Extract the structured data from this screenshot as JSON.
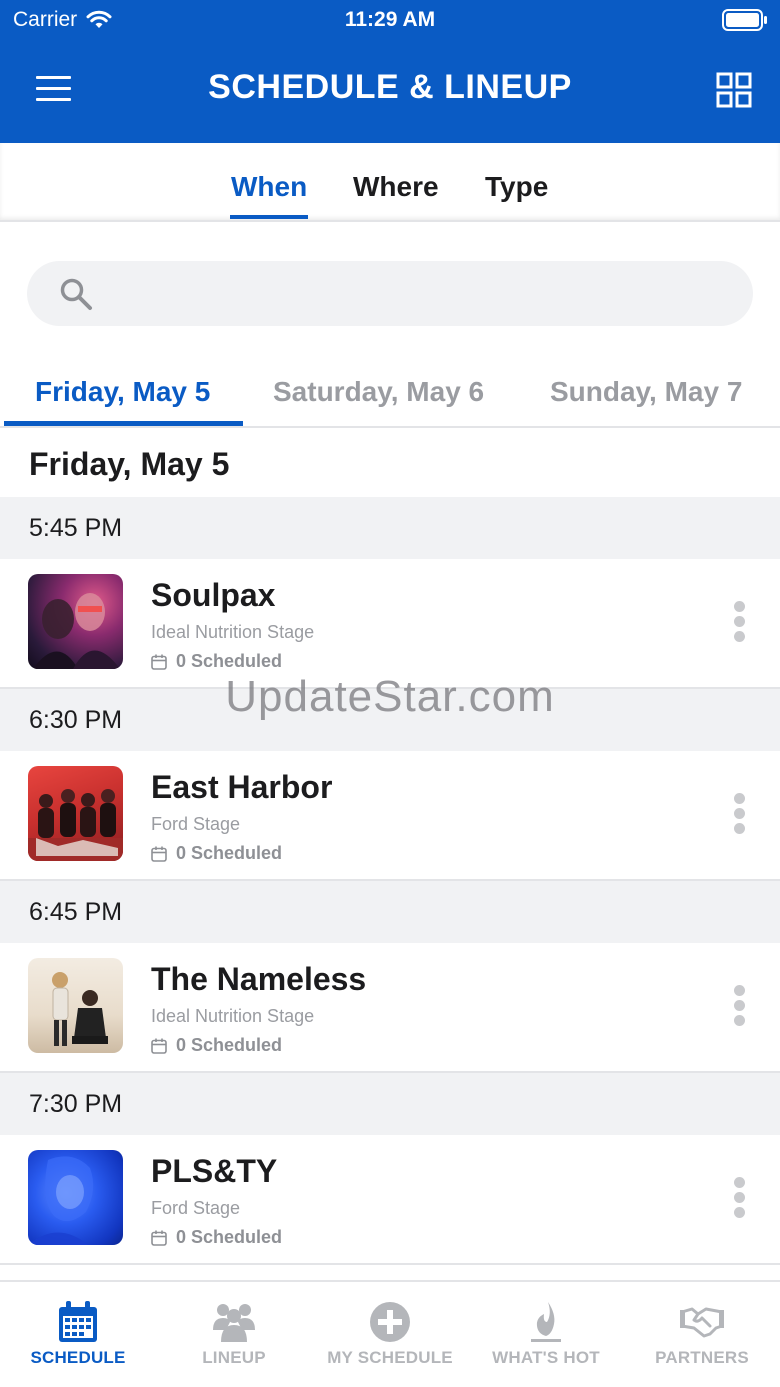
{
  "status_bar": {
    "carrier": "Carrier",
    "time": "11:29 AM"
  },
  "header": {
    "title": "SCHEDULE & LINEUP",
    "menu_icon": "hamburger-menu-icon",
    "grid_icon": "grid-view-icon"
  },
  "filter_tabs": [
    {
      "label": "When",
      "active": true
    },
    {
      "label": "Where",
      "active": false
    },
    {
      "label": "Type",
      "active": false
    }
  ],
  "search": {
    "placeholder": ""
  },
  "date_tabs": [
    {
      "label": "Friday, May 5",
      "active": true
    },
    {
      "label": "Saturday, May 6",
      "active": false
    },
    {
      "label": "Sunday, May 7",
      "active": false
    }
  ],
  "day_heading": "Friday, May 5",
  "sets": [
    {
      "time": "5:45 PM",
      "artist": "Soulpax",
      "stage": "Ideal Nutrition Stage",
      "scheduled": "0 Scheduled"
    },
    {
      "time": "6:30 PM",
      "artist": "East Harbor",
      "stage": "Ford Stage",
      "scheduled": "0 Scheduled"
    },
    {
      "time": "6:45 PM",
      "artist": "The Nameless",
      "stage": "Ideal Nutrition Stage",
      "scheduled": "0 Scheduled"
    },
    {
      "time": "7:30 PM",
      "artist": "PLS&TY",
      "stage": "Ford Stage",
      "scheduled": "0 Scheduled"
    }
  ],
  "watermark": "UpdateStar.com",
  "tab_bar": [
    {
      "label": "SCHEDULE",
      "icon": "calendar-icon",
      "active": true
    },
    {
      "label": "LINEUP",
      "icon": "people-icon",
      "active": false
    },
    {
      "label": "MY SCHEDULE",
      "icon": "plus-circle-icon",
      "active": false
    },
    {
      "label": "WHAT'S HOT",
      "icon": "flame-icon",
      "active": false
    },
    {
      "label": "PARTNERS",
      "icon": "handshake-icon",
      "active": false
    }
  ],
  "colors": {
    "brand_blue": "#0a5bc4",
    "muted_gray": "#9a9ca1",
    "section_bg": "#f1f2f4"
  }
}
